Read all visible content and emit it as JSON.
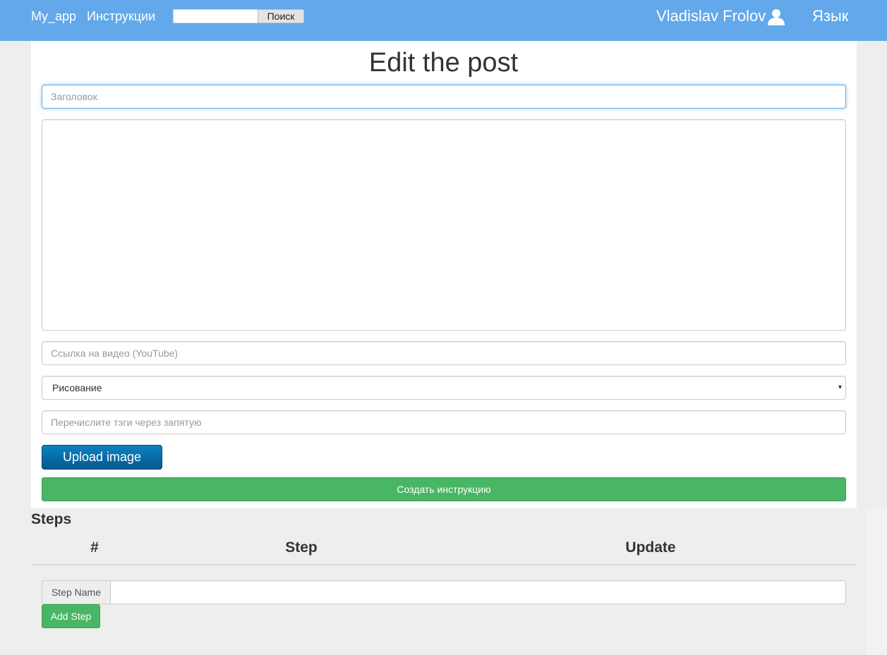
{
  "navbar": {
    "brand": "My_app",
    "instructions_link": "Инструкции",
    "search_placeholder": "",
    "search_button": "Поиск",
    "user_name": "Vladislav Frolov",
    "user_icon": "user-icon",
    "language_link": "Язык"
  },
  "form": {
    "title": "Edit the post",
    "title_placeholder": "Заголовок",
    "body_value": "",
    "video_placeholder": "Ссылка на видео (YouTube)",
    "category_selected": "Рисование",
    "tags_placeholder": "Перечислите тэги через запятую",
    "upload_button": "Upload image",
    "create_button": "Создать инструкцию"
  },
  "steps": {
    "heading": "Steps",
    "columns": [
      "#",
      "Step",
      "Update"
    ],
    "rows": [],
    "step_name_label": "Step Name",
    "step_name_value": "",
    "add_button": "Add Step"
  },
  "colors": {
    "navbar": "#62a8ea",
    "success": "#48b664",
    "upload": "#05598c",
    "focus_border": "#66afe9"
  }
}
